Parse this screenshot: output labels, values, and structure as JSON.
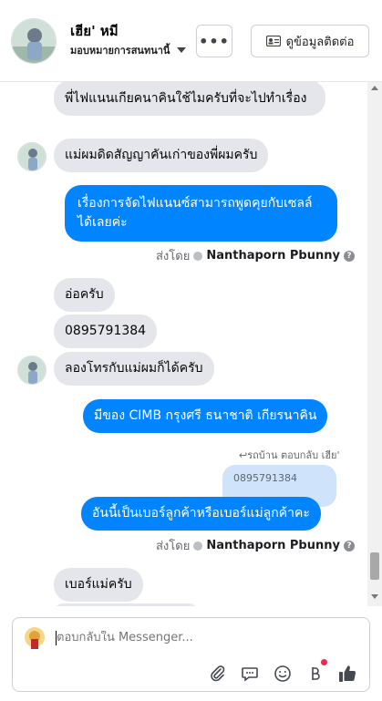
{
  "header": {
    "contact_name": "เฮีย' หมี",
    "assign_label": "มอบหมายการสนทนานี้",
    "more_label": "•••",
    "info_button_label": "ดูข้อมูลติดต่อ"
  },
  "messages": {
    "m1": "พี่ไฟแนนเกียคนาคินใช้ไมครับที่จะไปทำเรื่อง",
    "m2": "แม่ผมดิดสัญญาคันเก่าของพี่ผมครับ",
    "m3": "เรื่องการจัดไฟแนนซ์สามารถพูดคุยกับเซลล์ได้เลยค่ะ",
    "sent_by_label": "ส่งโดย",
    "sender_name": "Nanthaporn Pbunny",
    "m4": "อ่อครับ",
    "m5": "0895791384",
    "m6": "ลองโทรกับแม่ผมก็ได้ครับ",
    "m7": "มีของ CIMB กรุงศรี ธนาชาติ เกียรนาคิน",
    "reply_meta": "รถบ้าน ตอบกลับ เฮีย'",
    "quoted_text": "0895791384",
    "m8": "อันนี้เป็นเบอร์ลูกค้าหรือเบอร์แม่ลูกค้าคะ",
    "m9": "เบอร์แม่ครับ"
  },
  "composer": {
    "placeholder": "ตอบกลับใน Messenger..."
  },
  "colors": {
    "outgoing": "#0084ff",
    "incoming": "#e4e6eb",
    "notification_dot": "#f02849"
  },
  "icons": [
    "more-icon",
    "contact-card-icon",
    "attach-icon",
    "saved-reply-icon",
    "emoji-icon",
    "payment-icon",
    "like-icon"
  ]
}
